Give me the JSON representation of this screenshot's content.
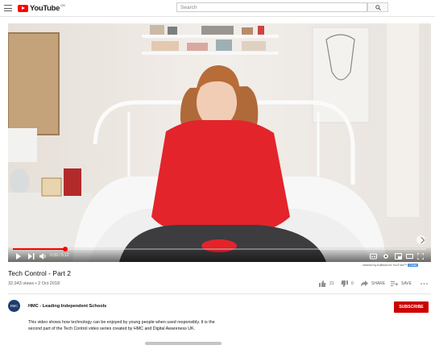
{
  "masthead": {
    "logo_text": "YouTube",
    "region": "GB",
    "search_placeholder": "Search",
    "menu_icon": "hamburger-menu-icon",
    "search_icon": "search-icon"
  },
  "player": {
    "time": "0:39 / 5:12",
    "progress": 0.127,
    "icons": [
      "play-icon",
      "next-icon",
      "volume-icon",
      "subtitles-icon",
      "settings-icon",
      "miniplayer-icon",
      "theater-icon",
      "cast-icon",
      "fullscreen-icon"
    ],
    "accent_color": "#ff0000"
  },
  "adblock_note": {
    "text": "cleaned by AdBlock for YouTube™",
    "badge": "Close"
  },
  "video": {
    "title": "Tech Control - Part 2",
    "views": "32,943 views",
    "date": "2 Oct 2018",
    "likes": "21",
    "dislikes": "0",
    "share_label": "SHARE",
    "save_label": "SAVE"
  },
  "channel": {
    "avatar_text": "HMC",
    "name": "HMC - Leading Independent Schools",
    "subscribe_label": "SUBSCRIBE",
    "subscribe_color": "#cc0000"
  },
  "description": {
    "line1": "This video shows how technology can be enjoyed by young people when used responsibly. It is the",
    "line2": "second part of the Tech Control video series created by HMC and Digital Awareness UK."
  }
}
